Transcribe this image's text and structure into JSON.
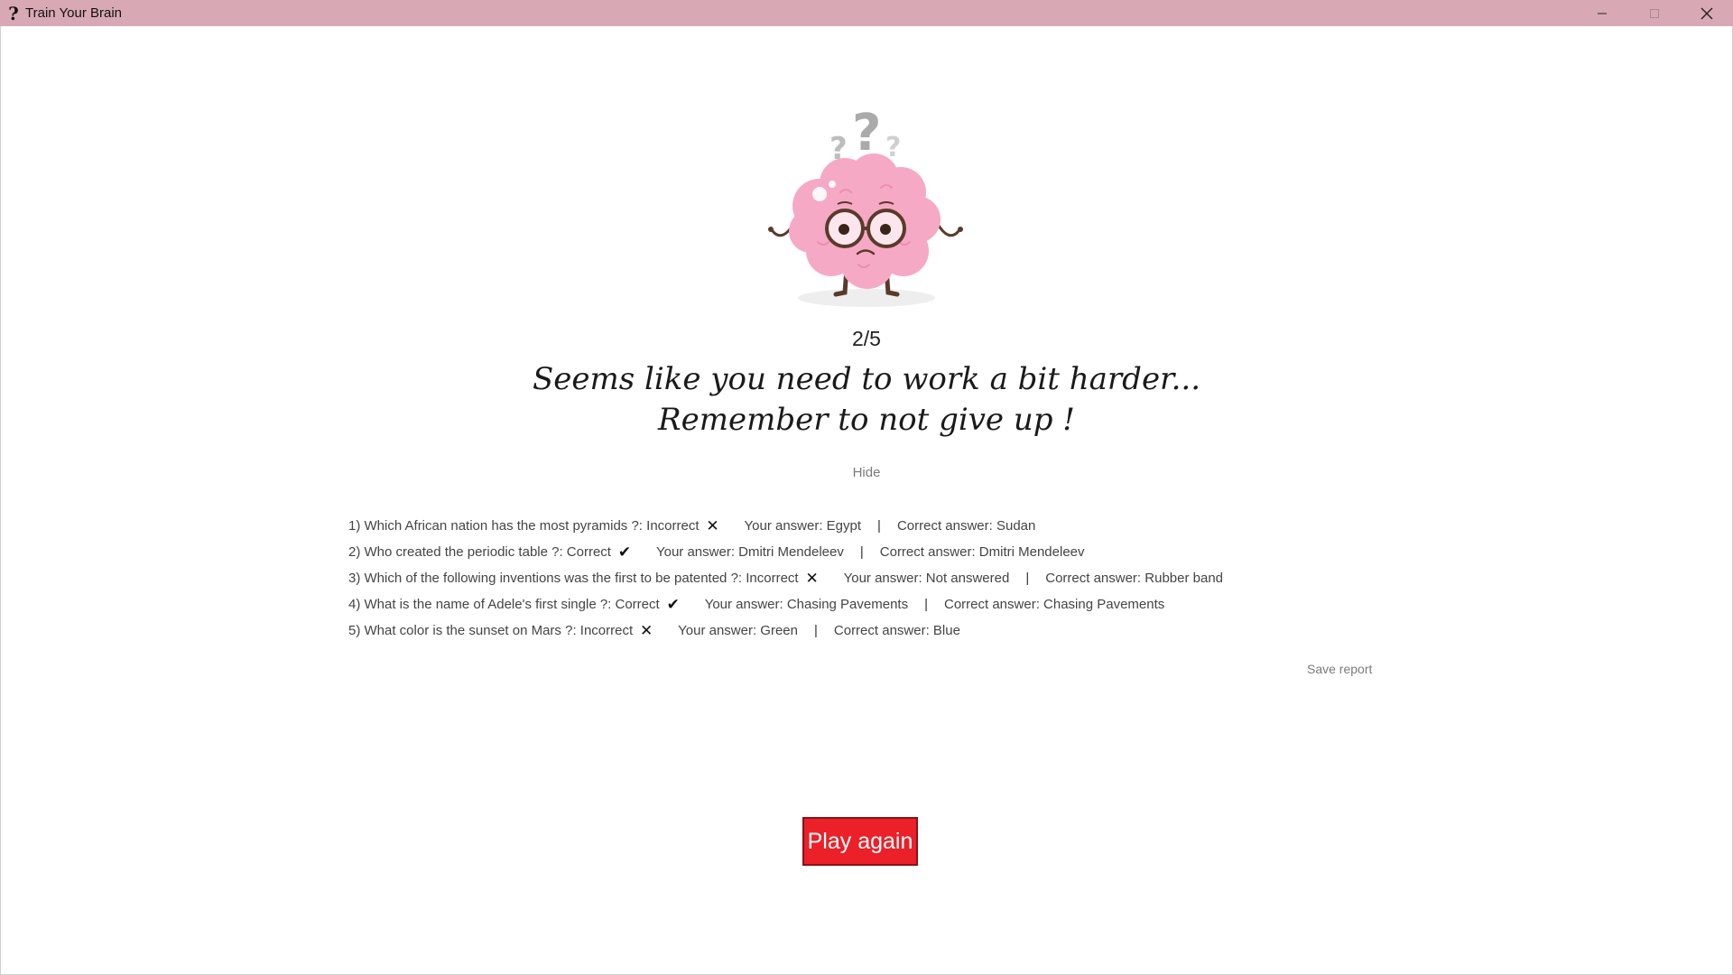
{
  "window": {
    "title": "Train Your Brain",
    "icon": "?"
  },
  "result": {
    "score": "2/5",
    "message_line1": "Seems like you need to work a bit harder...",
    "message_line2": "Remember to not give up !",
    "hide_label": "Hide",
    "save_label": "Save report",
    "play_again_label": "Play again"
  },
  "report": {
    "your_answer_prefix": "Your answer:",
    "correct_answer_prefix": "Correct answer:",
    "separator": "|",
    "rows": [
      {
        "question": "1) Which African nation has the most pyramids ?: Incorrect",
        "mark": "✕",
        "your_answer": "Your answer: Egypt",
        "correct_answer": "Correct answer: Sudan",
        "correct": false
      },
      {
        "question": "2) Who created the periodic table ?: Correct",
        "mark": "✔",
        "your_answer": "Your answer: Dmitri Mendeleev",
        "correct_answer": "Correct answer: Dmitri Mendeleev",
        "correct": true
      },
      {
        "question": "3) Which of the following inventions was the first to be patented ?: Incorrect",
        "mark": "✕",
        "your_answer": "Your answer: Not answered",
        "correct_answer": "Correct answer: Rubber band",
        "correct": false
      },
      {
        "question": "4) What is the name of Adele's first single ?: Correct",
        "mark": "✔",
        "your_answer": "Your answer: Chasing Pavements",
        "correct_answer": "Correct answer: Chasing Pavements",
        "correct": true
      },
      {
        "question": "5) What color is the sunset on Mars ?: Incorrect",
        "mark": "✕",
        "your_answer": "Your answer: Green",
        "correct_answer": "Correct answer: Blue",
        "correct": false
      }
    ]
  },
  "colors": {
    "titlebar": "#d8a9b5",
    "play_button": "#ec2028",
    "brain": "#f6a9c4"
  }
}
